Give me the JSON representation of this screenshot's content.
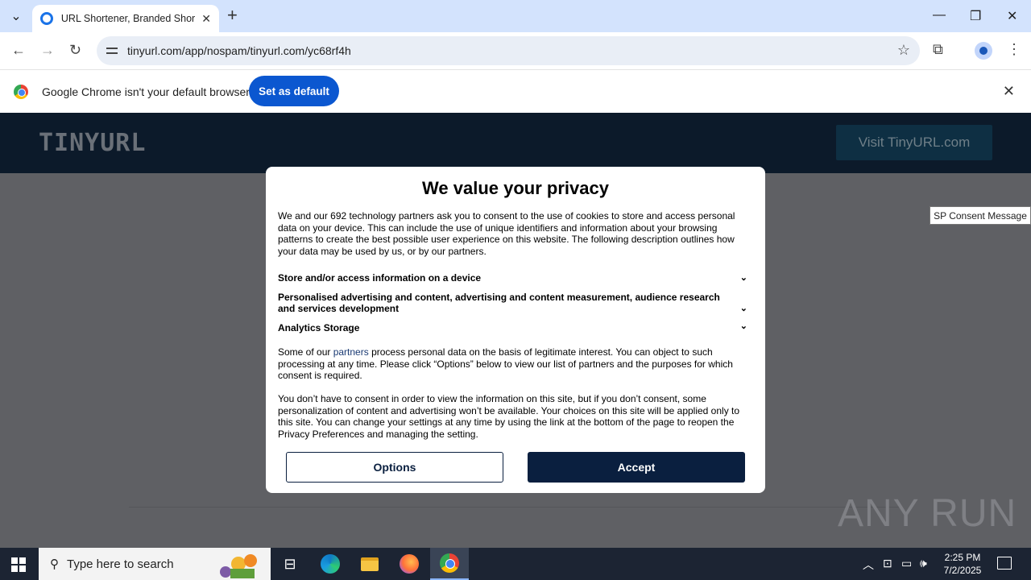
{
  "browser": {
    "tab_title": "URL Shortener, Branded Short L",
    "url": "tinyurl.com/app/nospam/tinyurl.com/yc68rf4h",
    "infobar_text": "Google Chrome isn't your default browser",
    "set_default_label": "Set as default"
  },
  "site": {
    "logo": "TINYURL",
    "visit_button": "Visit TinyURL.com",
    "tooltip": "SP Consent Message"
  },
  "modal": {
    "title": "We value your privacy",
    "intro": "We and our 692 technology partners ask you to consent to the use of cookies to store and access personal data on your device. This can include the use of unique identifiers and information about your browsing patterns to create the best possible user experience on this website. The following description outlines how your data may be used by us, or by our partners.",
    "purposes": [
      "Store and/or access information on a device",
      "Personalised advertising and content, advertising and content measurement, audience research and services development",
      "Analytics Storage"
    ],
    "legit_before": "Some of our ",
    "legit_link": "partners",
    "legit_after": " process personal data on the basis of legitimate interest. You can object to such processing at any time. Please click “Options” below to view our list of partners and the purposes for which consent is required.",
    "consent_text": "You don’t have to consent in order to view the information on this site, but if you don’t consent, some personalization of content and advertising won’t be available. Your choices on this site will be applied only to this site. You can change your settings at any time by using the link at the bottom of the page to reopen the Privacy Preferences and managing the setting.",
    "options_label": "Options",
    "accept_label": "Accept"
  },
  "watermark": "ANY RUN",
  "taskbar": {
    "search_placeholder": "Type here to search",
    "time": "2:25 PM",
    "date": "7/2/2025"
  }
}
